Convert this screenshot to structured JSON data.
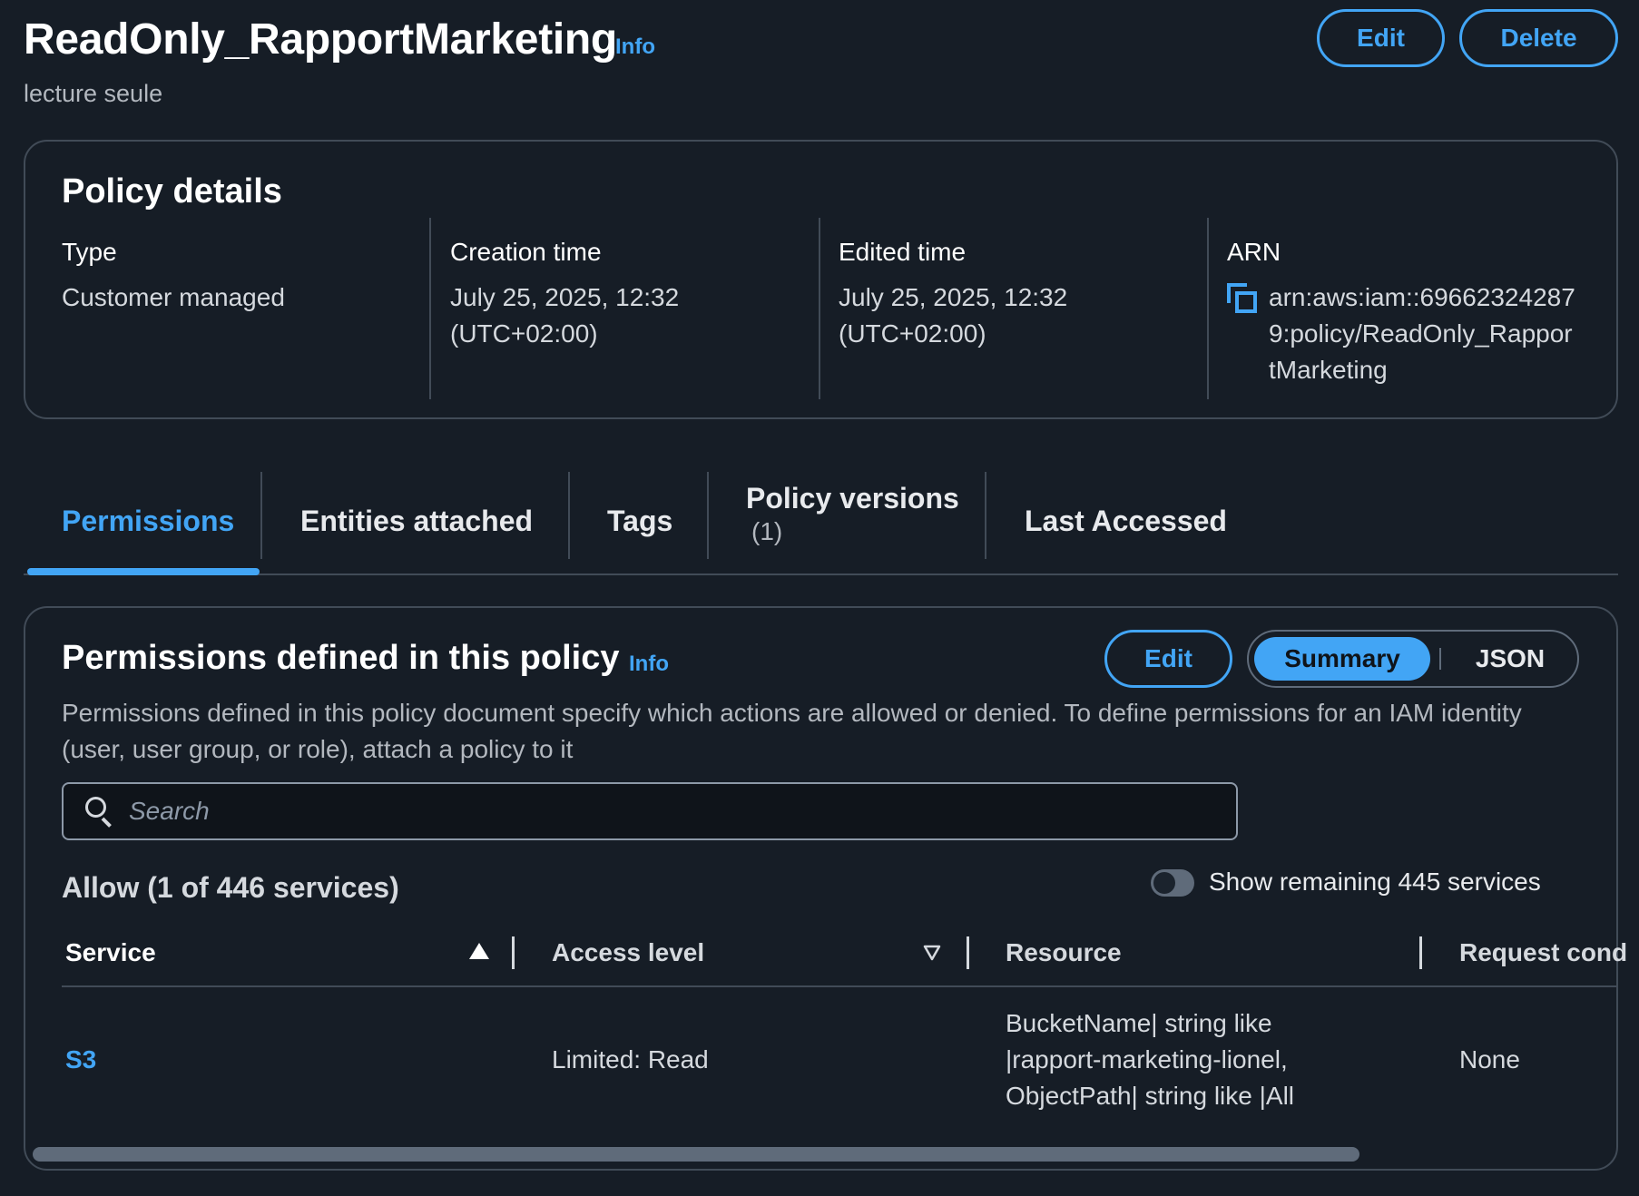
{
  "header": {
    "title": "ReadOnly_RapportMarketing",
    "info": "Info",
    "subtitle": "lecture seule",
    "edit_label": "Edit",
    "delete_label": "Delete"
  },
  "policy_details": {
    "title": "Policy details",
    "type_label": "Type",
    "type_value": "Customer managed",
    "creation_label": "Creation time",
    "creation_value": "July 25, 2025, 12:32 (UTC+02:00)",
    "edited_label": "Edited time",
    "edited_value": "July 25, 2025, 12:32 (UTC+02:00)",
    "arn_label": "ARN",
    "arn_value": "arn:aws:iam::696623242879:policy/ReadOnly_RapportMarketing"
  },
  "tabs": [
    {
      "label": "Permissions",
      "active": true
    },
    {
      "label": "Entities attached"
    },
    {
      "label": "Tags"
    },
    {
      "label": "Policy versions",
      "count": "(1)"
    },
    {
      "label": "Last Accessed"
    }
  ],
  "permissions": {
    "title": "Permissions defined in this policy",
    "info": "Info",
    "edit_label": "Edit",
    "view_summary": "Summary",
    "view_json": "JSON",
    "description": "Permissions defined in this policy document specify which actions are allowed or denied. To define permissions for an IAM identity (user, user group, or role), attach a policy to it",
    "search_placeholder": "Search",
    "allow_title": "Allow (1 of 446 services)",
    "toggle_label": "Show remaining 445 services",
    "columns": [
      "Service",
      "Access level",
      "Resource",
      "Request cond"
    ],
    "rows": [
      {
        "service": "S3",
        "access_level": "Limited: Read",
        "resource": "BucketName| string like |rapport-marketing-lionel, ObjectPath| string like |All",
        "request_condition": "None"
      }
    ]
  },
  "colors": {
    "background": "#161d26",
    "accent": "#42a5f5",
    "border": "#414b57",
    "text_primary": "#ffffff",
    "text_secondary": "#b3b8bf"
  }
}
